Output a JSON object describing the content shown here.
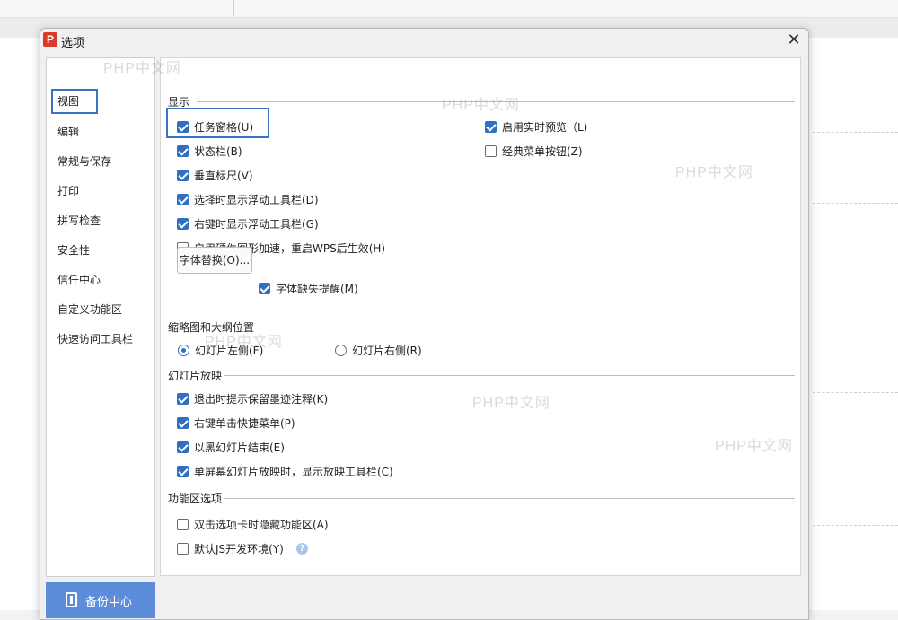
{
  "dialog": {
    "logo_letter": "P",
    "title": "选项",
    "close_symbol": "✕"
  },
  "nav": {
    "items": [
      {
        "label": "视图",
        "selected": true
      },
      {
        "label": "编辑"
      },
      {
        "label": "常规与保存"
      },
      {
        "label": "打印"
      },
      {
        "label": "拼写检查"
      },
      {
        "label": "安全性"
      },
      {
        "label": "信任中心"
      },
      {
        "label": "自定义功能区"
      },
      {
        "label": "快速访问工具栏"
      }
    ],
    "backup_label": "备份中心"
  },
  "display": {
    "title": "显示",
    "task_pane": {
      "label": "任务窗格(U)",
      "checked": true
    },
    "status_bar": {
      "label": "状态栏(B)",
      "checked": true
    },
    "vertical_ruler": {
      "label": "垂直标尺(V)",
      "checked": true
    },
    "float_toolbar_select": {
      "label": "选择时显示浮动工具栏(D)",
      "checked": true
    },
    "float_toolbar_right": {
      "label": "右键时显示浮动工具栏(G)",
      "checked": true
    },
    "hw_accel": {
      "label": "启用硬件图形加速，重启WPS后生效(H)",
      "checked": false
    },
    "live_preview": {
      "label": "启用实时预览（L)",
      "checked": true
    },
    "classic_menu": {
      "label": "经典菜单按钮(Z)",
      "checked": false
    },
    "font_substitute_button": "字体替换(O)...",
    "font_missing": {
      "label": "字体缺失提醒(M)",
      "checked": true
    }
  },
  "thumbnail": {
    "title": "缩略图和大纲位置",
    "left": {
      "label": "幻灯片左侧(F)",
      "checked": true
    },
    "right": {
      "label": "幻灯片右侧(R)",
      "checked": false
    }
  },
  "slideshow": {
    "title": "幻灯片放映",
    "ink_prompt": {
      "label": "退出时提示保留墨迹注释(K)",
      "checked": true
    },
    "right_click_menu": {
      "label": "右键单击快捷菜单(P)",
      "checked": true
    },
    "end_black": {
      "label": "以黑幻灯片结束(E)",
      "checked": true
    },
    "single_screen_toolbar": {
      "label": "单屏幕幻灯片放映时，显示放映工具栏(C)",
      "checked": true
    }
  },
  "ribbon": {
    "title": "功能区选项",
    "dblclick_hide": {
      "label": "双击选项卡时隐藏功能区(A)",
      "checked": false
    },
    "js_dev": {
      "label": "默认JS开发环境(Y)",
      "checked": false
    },
    "help_symbol": "?"
  },
  "watermark_text": "PHP中文网",
  "colors": {
    "accent": "#2f6fc5",
    "highlight": "#3a72c4",
    "backup_button": "#5b8ddb",
    "logo": "#d83b2b"
  }
}
